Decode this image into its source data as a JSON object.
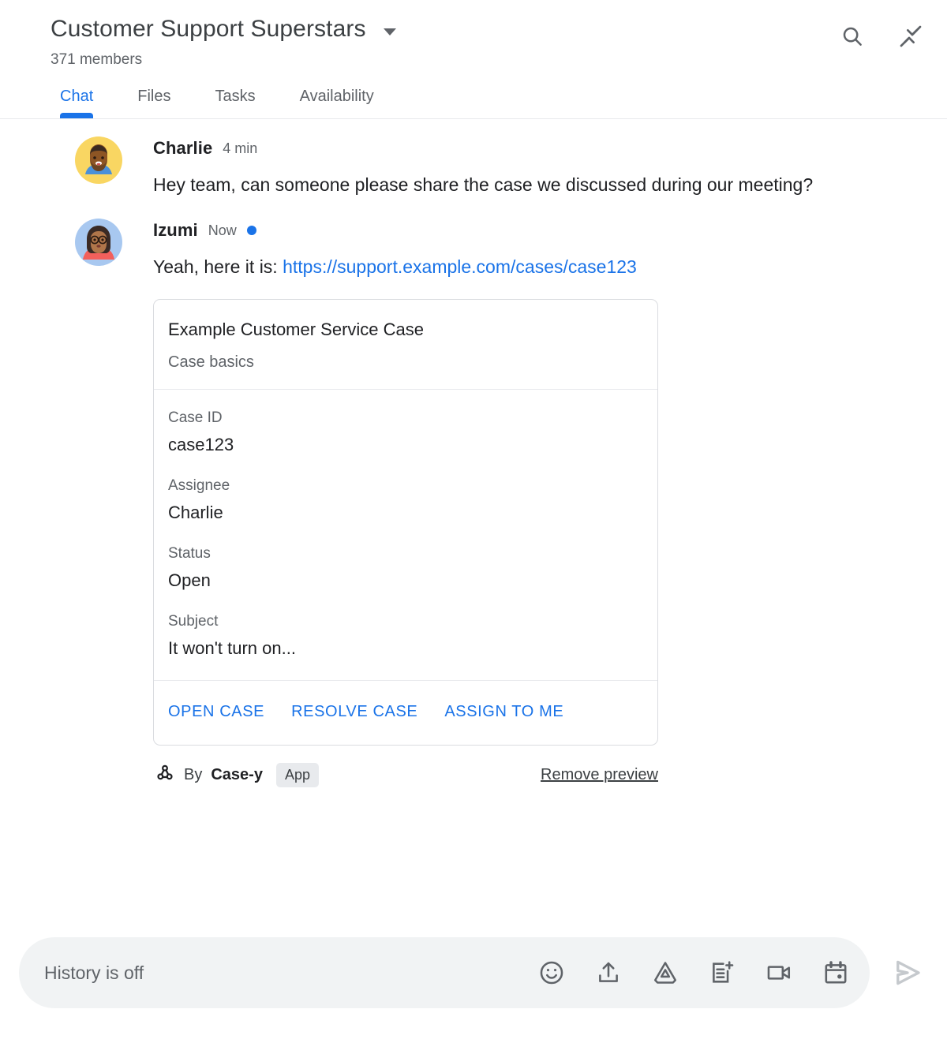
{
  "header": {
    "room_title": "Customer Support Superstars",
    "members": "371 members",
    "dropdown_icon": "chevron-down-icon",
    "search_icon": "search-icon",
    "collapse_icon": "collapse-icon"
  },
  "tabs": [
    {
      "label": "Chat",
      "active": true
    },
    {
      "label": "Files",
      "active": false
    },
    {
      "label": "Tasks",
      "active": false
    },
    {
      "label": "Availability",
      "active": false
    }
  ],
  "messages": [
    {
      "sender": "Charlie",
      "timestamp": "4 min",
      "unread": false,
      "text": "Hey team, can someone please share the case we discussed during our meeting?"
    },
    {
      "sender": "Izumi",
      "timestamp": "Now",
      "unread": true,
      "text_before_link": "Yeah, here it is: ",
      "link_text": "https://support.example.com/cases/case123"
    }
  ],
  "card": {
    "title": "Example Customer Service Case",
    "subtitle": "Case basics",
    "fields": [
      {
        "label": "Case ID",
        "value": "case123"
      },
      {
        "label": "Assignee",
        "value": "Charlie"
      },
      {
        "label": "Status",
        "value": "Open"
      },
      {
        "label": "Subject",
        "value": "It won't turn on..."
      }
    ],
    "actions": [
      {
        "label": "OPEN CASE"
      },
      {
        "label": "RESOLVE CASE"
      },
      {
        "label": "ASSIGN TO ME"
      }
    ]
  },
  "attribution": {
    "bot_icon": "webhook-icon",
    "by_text": "By",
    "app_name": "Case-y",
    "badge": "App",
    "remove_preview": "Remove preview"
  },
  "composer": {
    "placeholder": "History is off",
    "value": "",
    "icons": [
      {
        "name": "emoji-icon"
      },
      {
        "name": "upload-icon"
      },
      {
        "name": "drive-icon"
      },
      {
        "name": "new-doc-icon"
      },
      {
        "name": "video-camera-icon"
      },
      {
        "name": "calendar-icon"
      }
    ],
    "send_icon": "send-icon"
  },
  "colors": {
    "accent_blue": "#1a73e8",
    "link_blue": "#1a73e8",
    "text_primary": "#202124",
    "text_secondary": "#5f6368",
    "border": "#dadce0",
    "composer_bg": "#f1f3f4",
    "badge_bg": "#e8eaed",
    "send_disabled": "#c5c9cd"
  }
}
